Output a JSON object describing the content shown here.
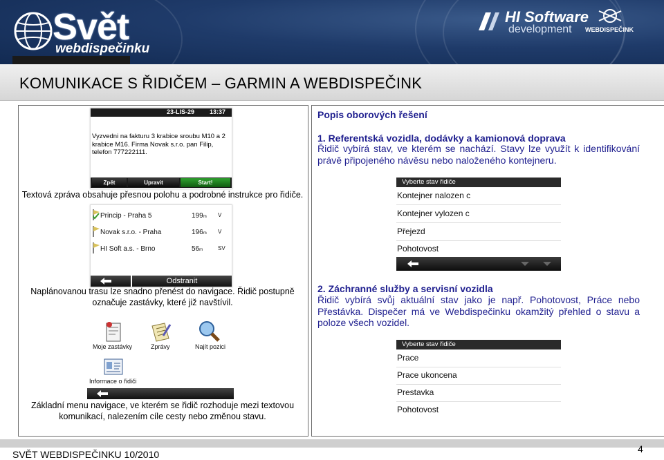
{
  "header": {
    "logo_main": "Svět",
    "logo_sub": "webdispečinku",
    "partner_name": "HI Software",
    "partner_sub": "development",
    "partner2": "WEBDISPEČINK"
  },
  "title": "KOMUNIKACE S ŘIDIČEM – GARMIN A WEBDISPEČINK",
  "device_message": {
    "date": "23-LIS-29",
    "time": "13:37",
    "text": "Vyzvedni na fakturu 3 krabice sroubu M10 a 2 krabice M16. Firma Novak s.r.o. pan Filip, telefon 777222111.",
    "btn_back": "Zpět",
    "btn_edit": "Upravit",
    "btn_start": "Start!"
  },
  "caption1": "Textová zpráva obsahuje přesnou polohu a podrobné instrukce pro řidiče.",
  "route": {
    "rows": [
      {
        "name": "Princip - Praha 5",
        "dist": "199",
        "unit": "m",
        "dir": "V"
      },
      {
        "name": "Novak s.r.o. - Praha",
        "dist": "196",
        "unit": "m",
        "dir": "V"
      },
      {
        "name": "HI Soft a.s. - Brno",
        "dist": "56",
        "unit": "m",
        "dir": "SV"
      }
    ],
    "remove_label": "Odstranit"
  },
  "caption2": "Naplánovanou trasu lze snadno přenést do navigace. Řidič postupně označuje zastávky, které již navštívil.",
  "menu": {
    "items": [
      "Moje zastávky",
      "Zprávy",
      "Najít pozici",
      "Informace o řidiči"
    ]
  },
  "caption3": "Základní menu navigace, ve kterém se řidič rozhoduje mezi textovou komunikací, nalezením cíle cesty nebo změnou stavu.",
  "right": {
    "heading": "Popis oborových řešení",
    "s1_title": "1. Referentská vozidla, dodávky a kamionová doprava",
    "s1_body": "Řidič vybírá stav, ve kterém se nachází. Stavy lze využít k identifikování právě připojeného návěsu nebo naloženého kontejneru.",
    "picker1": {
      "head": "Vyberte stav řidiče",
      "rows": [
        "Kontejner nalozen c",
        "Kontejner vylozen c",
        "Přejezd",
        "Pohotovost"
      ]
    },
    "s2_title": "2. Záchranné služby a servisní vozidla",
    "s2_body": "Řidič vybírá svůj aktuální stav jako je např. Pohotovost, Práce nebo Přestávka. Dispečer má ve Webdispečinku okamžitý přehled o stavu a poloze všech vozidel.",
    "picker2": {
      "head": "Vyberte stav řidiče",
      "rows": [
        "Prace",
        "Prace ukoncena",
        "Prestavka",
        "Pohotovost"
      ]
    }
  },
  "footer": {
    "text": "SVĚT WEBDISPEČINKU 10/2010",
    "page": "4"
  }
}
